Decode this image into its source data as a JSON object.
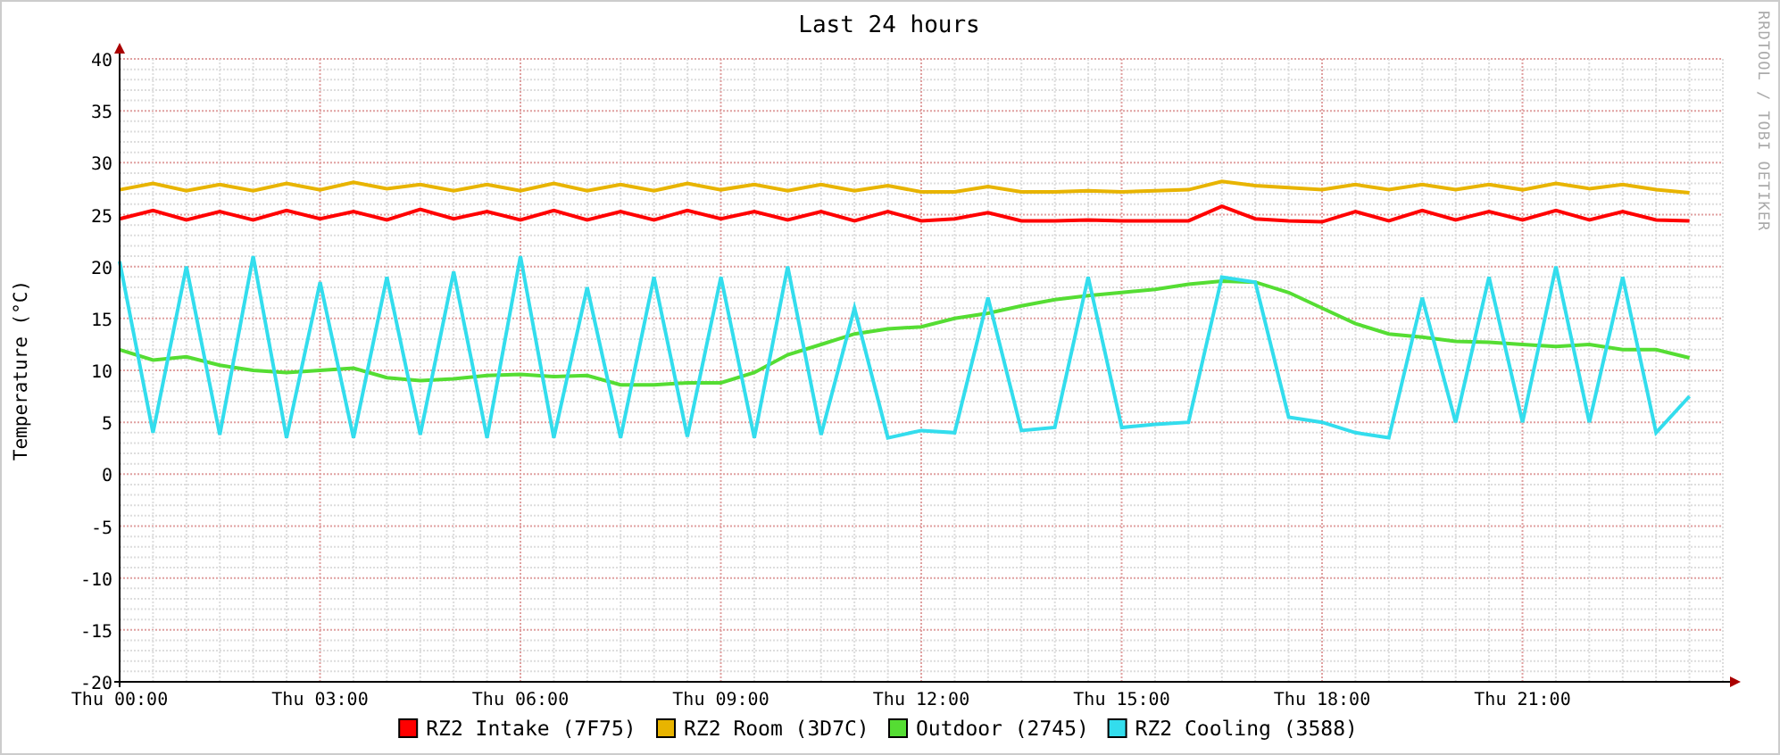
{
  "graph": {
    "credit": "RRDTOOL / TOBI OETIKER",
    "chart_data": {
      "type": "line",
      "title": "Last 24 hours",
      "ylabel": "Temperature (°C)",
      "ylim": [
        -20,
        40
      ],
      "grid": true,
      "legend": "bottom",
      "yticks": [
        -20,
        -15,
        -10,
        -5,
        0,
        5,
        10,
        15,
        20,
        25,
        30,
        35,
        40
      ],
      "categories": [
        "Thu 00:00",
        null,
        null,
        null,
        null,
        null,
        "Thu 03:00",
        null,
        null,
        null,
        null,
        null,
        "Thu 06:00",
        null,
        null,
        null,
        null,
        null,
        "Thu 09:00",
        null,
        null,
        null,
        null,
        null,
        "Thu 12:00",
        null,
        null,
        null,
        null,
        null,
        "Thu 15:00",
        null,
        null,
        null,
        null,
        null,
        "Thu 18:00",
        null,
        null,
        null,
        null,
        null,
        "Thu 21:00",
        null,
        null,
        null,
        null,
        null
      ],
      "series": [
        {
          "name": "RZ2 Intake (7F75)",
          "color": "#ff0000",
          "values": [
            24.6,
            25.4,
            24.5,
            25.3,
            24.5,
            25.4,
            24.6,
            25.3,
            24.5,
            25.5,
            24.6,
            25.3,
            24.5,
            25.4,
            24.5,
            25.3,
            24.5,
            25.4,
            24.6,
            25.3,
            24.5,
            25.3,
            24.4,
            25.3,
            24.4,
            24.6,
            25.2,
            24.4,
            24.4,
            24.5,
            24.4,
            24.4,
            24.4,
            25.8,
            24.6,
            24.4,
            24.3,
            25.3,
            24.4,
            25.4,
            24.5,
            25.3,
            24.5,
            25.4,
            24.5,
            25.3,
            24.5,
            24.4
          ]
        },
        {
          "name": "RZ2 Room (3D7C)",
          "color": "#e8b400",
          "values": [
            27.4,
            28.0,
            27.3,
            27.9,
            27.3,
            28.0,
            27.4,
            28.1,
            27.5,
            27.9,
            27.3,
            27.9,
            27.3,
            28.0,
            27.3,
            27.9,
            27.3,
            28.0,
            27.4,
            27.9,
            27.3,
            27.9,
            27.3,
            27.8,
            27.2,
            27.2,
            27.7,
            27.2,
            27.2,
            27.3,
            27.2,
            27.3,
            27.4,
            28.2,
            27.8,
            27.6,
            27.4,
            27.9,
            27.4,
            27.9,
            27.4,
            27.9,
            27.4,
            28.0,
            27.5,
            27.9,
            27.4,
            27.1
          ]
        },
        {
          "name": "Outdoor (2745)",
          "color": "#55dd33",
          "values": [
            12,
            11,
            11.3,
            10.5,
            10,
            9.8,
            10,
            10.2,
            9.3,
            9,
            9.2,
            9.5,
            9.6,
            9.4,
            9.5,
            8.6,
            8.6,
            8.8,
            8.8,
            9.8,
            11.5,
            12.5,
            13.5,
            14,
            14.2,
            15,
            15.5,
            16.2,
            16.8,
            17.2,
            17.5,
            17.8,
            18.3,
            18.6,
            18.5,
            17.5,
            16,
            14.5,
            13.5,
            13.2,
            12.8,
            12.7,
            12.5,
            12.3,
            12.5,
            12,
            12,
            11.2
          ]
        },
        {
          "name": "RZ2 Cooling (3588)",
          "color": "#33dded",
          "values": [
            20.5,
            4,
            20,
            3.8,
            21,
            3.5,
            18.5,
            3.5,
            19,
            3.8,
            19.5,
            3.5,
            21,
            3.5,
            18,
            3.5,
            19,
            3.6,
            19,
            3.5,
            20,
            3.8,
            16,
            3.5,
            4.2,
            4,
            17,
            4.2,
            4.5,
            19,
            4.5,
            4.8,
            5,
            19,
            18.5,
            5.5,
            5,
            4,
            3.5,
            17,
            5,
            19,
            5,
            20,
            5,
            19,
            4,
            7.5
          ]
        }
      ]
    }
  }
}
